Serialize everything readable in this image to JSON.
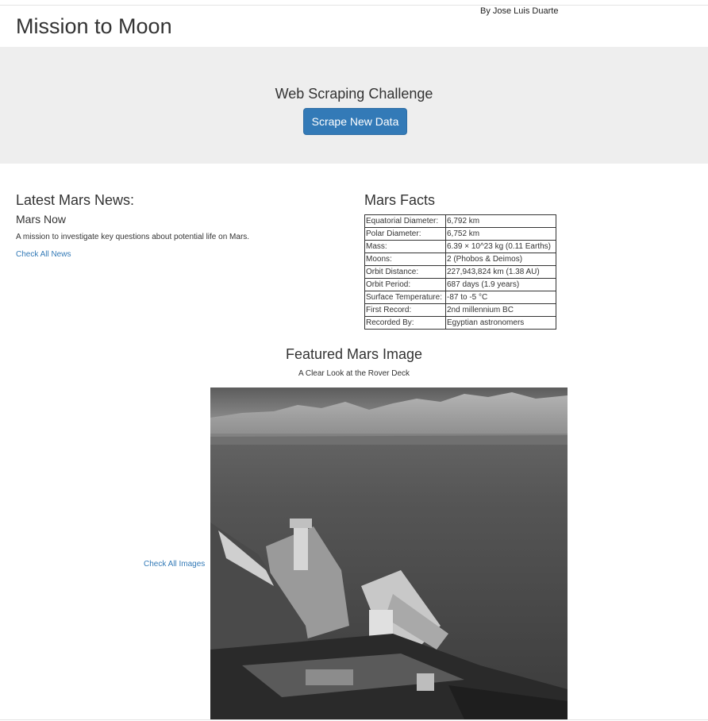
{
  "header": {
    "author": "By Jose Luis Duarte",
    "title": "Mission to Moon"
  },
  "jumbotron": {
    "heading": "Web Scraping Challenge",
    "button_label": "Scrape New Data"
  },
  "news": {
    "heading": "Latest Mars News:",
    "title": "Mars Now",
    "teaser": "A mission to investigate key questions about potential life on Mars.",
    "link_label": "Check All News"
  },
  "facts": {
    "heading": "Mars Facts",
    "rows": [
      {
        "label": "Equatorial Diameter:",
        "value": "6,792 km"
      },
      {
        "label": "Polar Diameter:",
        "value": "6,752 km"
      },
      {
        "label": "Mass:",
        "value": "6.39 × 10^23 kg (0.11 Earths)"
      },
      {
        "label": "Moons:",
        "value": "2 (Phobos & Deimos)"
      },
      {
        "label": "Orbit Distance:",
        "value": "227,943,824 km (1.38 AU)"
      },
      {
        "label": "Orbit Period:",
        "value": "687 days (1.9 years)"
      },
      {
        "label": "Surface Temperature:",
        "value": "-87 to -5 °C"
      },
      {
        "label": "First Record:",
        "value": "2nd millennium BC"
      },
      {
        "label": "Recorded By:",
        "value": "Egyptian astronomers"
      }
    ]
  },
  "featured": {
    "heading": "Featured Mars Image",
    "caption": "A Clear Look at the Rover Deck",
    "link_label": "Check All Images"
  },
  "colors": {
    "link": "#337ab7",
    "button": "#337ab7",
    "jumbotron_bg": "#eeeeee"
  }
}
